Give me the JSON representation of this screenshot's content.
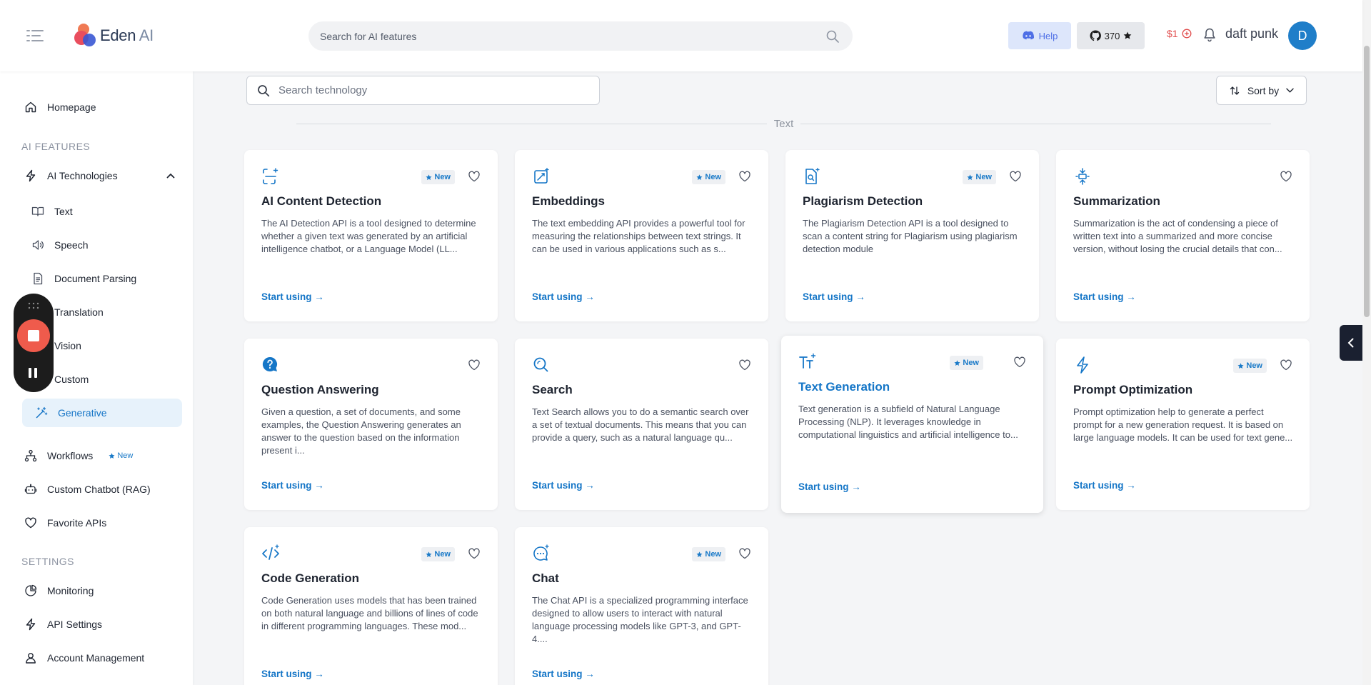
{
  "header": {
    "logo_name": "Eden",
    "logo_suffix": " AI",
    "search_placeholder": "Search for AI features",
    "help_label": "Help",
    "github_stars": "370",
    "credit": "$1",
    "username": "daft punk",
    "avatar_initial": "D"
  },
  "sidebar": {
    "homepage": "Homepage",
    "section_ai_features": "AI FEATURES",
    "ai_technologies": "AI Technologies",
    "sub_items": [
      "Text",
      "Speech",
      "Document Parsing",
      "Translation",
      "Vision",
      "Custom",
      "Generative"
    ],
    "workflows": "Workflows",
    "workflows_badge": "New",
    "custom_chatbot": "Custom Chatbot (RAG)",
    "favorite_apis": "Favorite APIs",
    "section_settings": "SETTINGS",
    "monitoring": "Monitoring",
    "api_settings": "API Settings",
    "account_management": "Account Management"
  },
  "main": {
    "search_placeholder": "Search technology",
    "sort_label": "Sort by",
    "section_label": "Text",
    "badge_label": "New",
    "start_label": "Start using",
    "cards": [
      {
        "title": "AI Content Detection",
        "desc": "The AI Detection API is a tool designed to determine whether a given text was generated by an artificial intelligence chatbot, or a Language Model (LL..."
      },
      {
        "title": "Embeddings",
        "desc": "The text embedding API provides a powerful tool for measuring the relationships between text strings. It can be used in various applications such as s..."
      },
      {
        "title": "Plagiarism Detection",
        "desc": "The Plagiarism Detection API is a tool designed to scan a content string for Plagiarism using plagiarism detection module"
      },
      {
        "title": "Summarization",
        "desc": "Summarization is the act of condensing a piece of written text into a summarized and more concise version, without losing the crucial details that con..."
      },
      {
        "title": "Question Answering",
        "desc": "Given a question, a set of documents, and some examples, the Question Answering generates an answer to the question based on the information present i..."
      },
      {
        "title": "Search",
        "desc": "Text Search allows you to do a semantic search over a set of textual documents. This means that you can provide a query, such as a natural language qu..."
      },
      {
        "title": "Text Generation",
        "desc": "Text generation is a subfield of Natural Language Processing (NLP). It leverages knowledge in computational linguistics and artificial intelligence to..."
      },
      {
        "title": "Prompt Optimization",
        "desc": "Prompt optimization help to generate a perfect prompt for a new generation request. It is based on large language models. It can be used for text gene..."
      },
      {
        "title": "Code Generation",
        "desc": "Code Generation uses models that has been trained on both natural language and billions of lines of code in different programming languages. These mod..."
      },
      {
        "title": "Chat",
        "desc": "The Chat API is a specialized programming interface designed to allow users to interact with natural language processing models like GPT-3, and GPT-4...."
      }
    ]
  },
  "colors": {
    "accent": "#1576c7",
    "recorder_stop": "#ef5b4c",
    "credit": "#e04a4a"
  },
  "icons": [
    "menu-icon",
    "search-icon",
    "discord-icon",
    "github-icon",
    "star-icon",
    "bell-icon",
    "home-icon",
    "bolt-icon",
    "book-icon",
    "speaker-icon",
    "document-icon",
    "language-icon",
    "eye-icon",
    "puzzle-icon",
    "magic-wand-icon",
    "workflow-icon",
    "chatbot-icon",
    "heart-icon",
    "chart-icon",
    "person-icon",
    "sort-icon",
    "chevron-down-icon",
    "chevron-left-icon"
  ]
}
